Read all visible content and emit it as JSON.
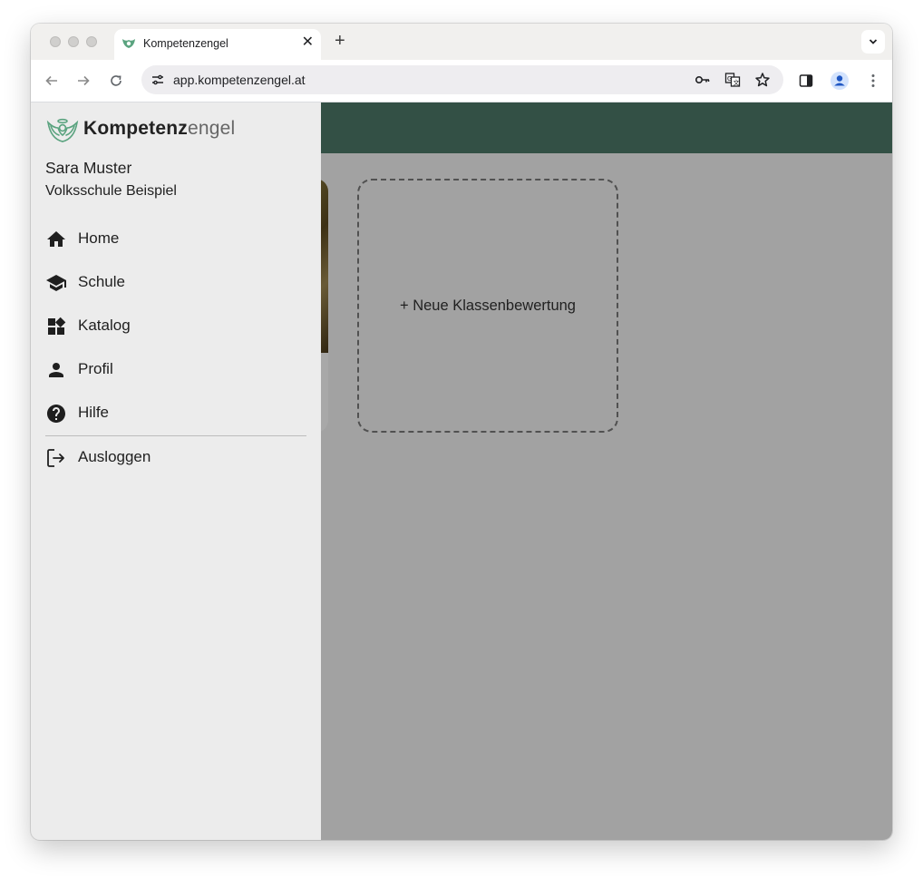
{
  "browser": {
    "tab_title": "Kompetenzengel",
    "url": "app.kompetenzengel.at"
  },
  "app": {
    "brand_bold": "Kompetenz",
    "brand_light": "engel",
    "header_color": "#4e7a6a",
    "add_class_label": "+ Neue Klassenbewertung"
  },
  "drawer": {
    "user_name": "Sara Muster",
    "school": "Volksschule Beispiel",
    "items": [
      {
        "label": "Home",
        "icon": "home-icon"
      },
      {
        "label": "Schule",
        "icon": "school-icon"
      },
      {
        "label": "Katalog",
        "icon": "widgets-icon"
      },
      {
        "label": "Profil",
        "icon": "person-icon"
      },
      {
        "label": "Hilfe",
        "icon": "help-icon"
      }
    ],
    "logout_label": "Ausloggen"
  }
}
